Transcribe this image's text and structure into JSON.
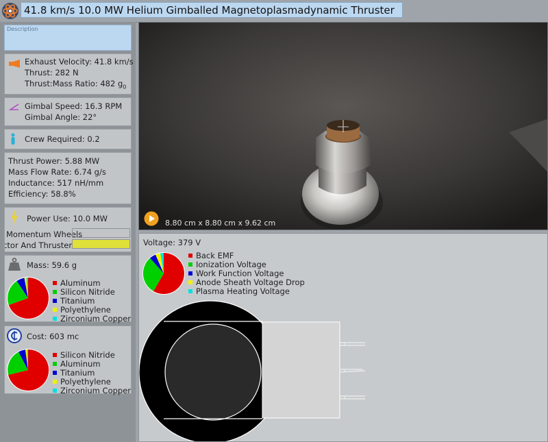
{
  "header": {
    "title": "41.8 km/s 10.0 MW Helium Gimballed Magnetoplasmadynamic Thruster",
    "logo_icon": "atom-icon"
  },
  "description": {
    "label": "Description"
  },
  "exhaust": {
    "velocity": "Exhaust Velocity: 41.8 km/s",
    "thrust": "Thrust: 282 N",
    "ratio": "Thrust:Mass Ratio: 482",
    "ratio_unit": "g",
    "ratio_unit_sub": "0",
    "icon": "exhaust-icon"
  },
  "gimbal": {
    "speed": "Gimbal Speed: 16.3 RPM",
    "angle": "Gimbal Angle: 22°",
    "icon": "gimbal-icon"
  },
  "crew": {
    "label": "Crew Required: 0.2",
    "icon": "crew-icon"
  },
  "power_stats": {
    "thrust_power": "Thrust Power: 5.88 MW",
    "mass_flow": "Mass Flow Rate: 6.74 g/s",
    "inductance": "Inductance: 517 nH/mm",
    "efficiency": "Efficiency: 58.8%"
  },
  "power_use": {
    "label": "Power Use: 10.0 MW",
    "icon": "lightning-icon",
    "item1": "Momentum Wheels",
    "item2": "ector And Thruster",
    "bar_color": "#dfe03a",
    "item1_fill": 0,
    "item2_fill": 1
  },
  "mass": {
    "label": "Mass: 59.6 g",
    "icon": "weight-icon",
    "legend": [
      {
        "name": "Aluminum",
        "color": "#e00000"
      },
      {
        "name": "Silicon Nitride",
        "color": "#00d000"
      },
      {
        "name": "Titanium",
        "color": "#0000d0"
      },
      {
        "name": "Polyethylene",
        "color": "#f0f000"
      },
      {
        "name": "Zirconium Copper",
        "color": "#00e0e0"
      }
    ]
  },
  "cost": {
    "label": "Cost: 603 mc",
    "icon": "credits-icon",
    "legend": [
      {
        "name": "Silicon Nitride",
        "color": "#e00000"
      },
      {
        "name": "Aluminum",
        "color": "#00d000"
      },
      {
        "name": "Titanium",
        "color": "#0000d0"
      },
      {
        "name": "Polyethylene",
        "color": "#f0f000"
      },
      {
        "name": "Zirconium Copper",
        "color": "#00e0e0"
      }
    ]
  },
  "viewport": {
    "dimensions": "8.80 cm x 8.80 cm x 9.62 cm",
    "play_icon": "play-icon"
  },
  "voltage": {
    "label": "Voltage: 379 V",
    "legend": [
      {
        "name": "Back EMF",
        "color": "#e00000"
      },
      {
        "name": "Ionization Voltage",
        "color": "#00d000"
      },
      {
        "name": "Work Function Voltage",
        "color": "#0000d0"
      },
      {
        "name": "Anode Sheath Voltage Drop",
        "color": "#f0f000"
      },
      {
        "name": "Plasma Heating Voltage",
        "color": "#00e0e0"
      }
    ]
  }
}
